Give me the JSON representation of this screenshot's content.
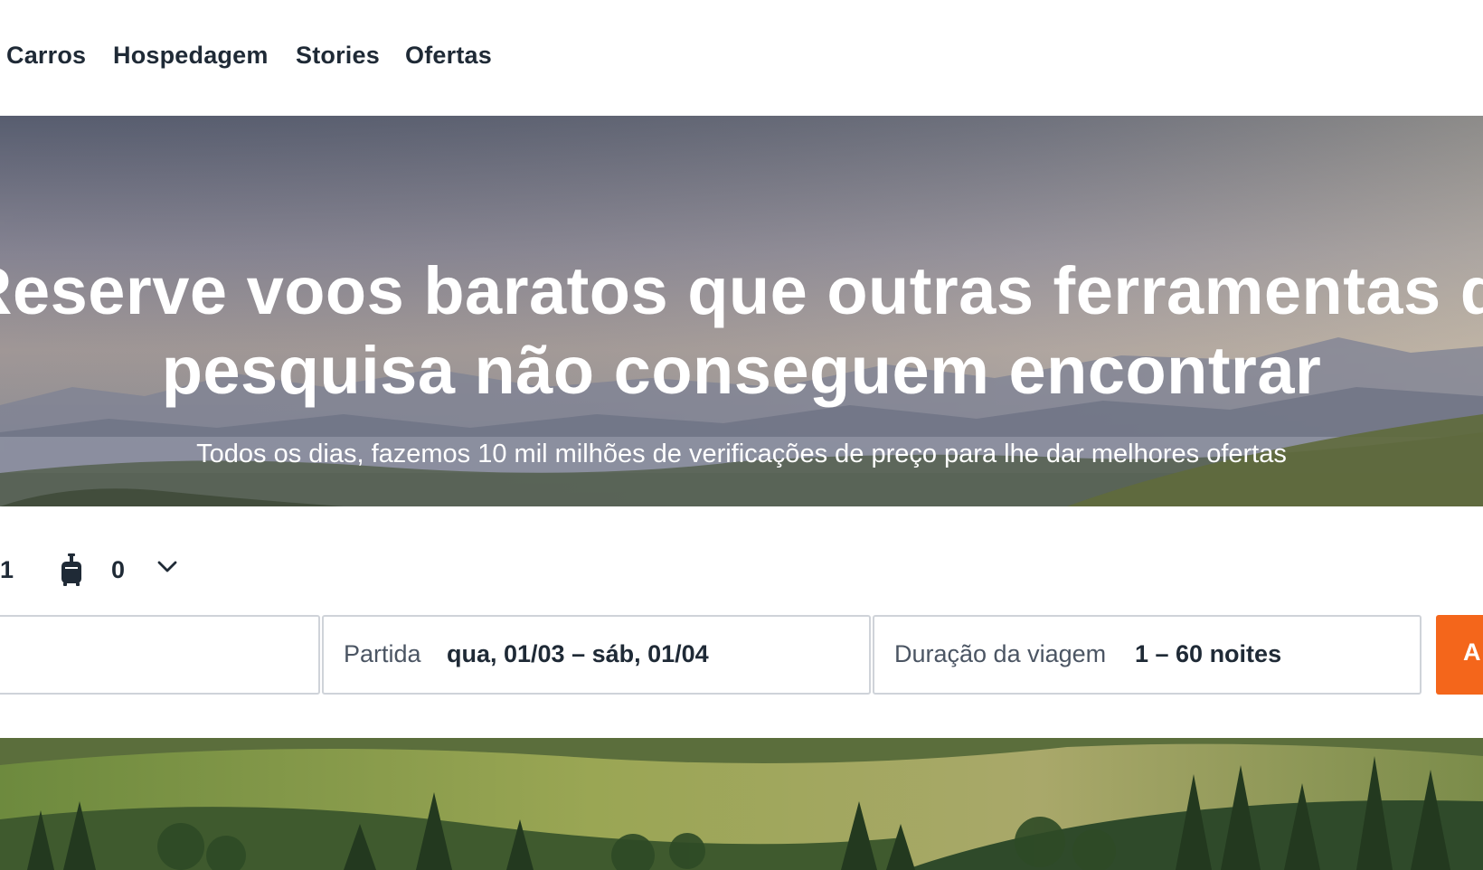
{
  "nav": {
    "items": [
      "Carros",
      "Hospedagem",
      "Stories",
      "Ofertas"
    ]
  },
  "hero": {
    "title_line1": "Reserve voos baratos que outras ferramentas de",
    "title_line2": "pesquisa não conseguem encontrar",
    "subtitle": "Todos os dias, fazemos 10 mil milhões de verificações de preço para lhe dar melhores ofertas"
  },
  "search": {
    "passengers_count": "1",
    "bags_count": "0",
    "bag_icon": "luggage-icon",
    "dropdown_icon": "chevron-down-icon",
    "departure": {
      "label": "Partida",
      "value": "qua, 01/03 – sáb, 01/04"
    },
    "duration": {
      "label": "Duração da viagem",
      "value": "1 – 60 noites"
    },
    "button_label": "A"
  },
  "colors": {
    "accent": "#f4661b",
    "text": "#1f2a36",
    "field_border": "#cfd3d9",
    "label": "#4b5563"
  }
}
